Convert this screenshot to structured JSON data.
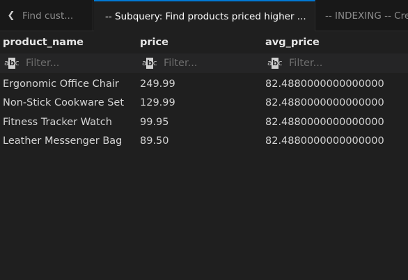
{
  "tabs": [
    {
      "label": "Find cust..."
    },
    {
      "label": "-- Subquery: Find products priced higher ..."
    },
    {
      "label": "-- INDEXING -- Cre"
    }
  ],
  "columns": [
    {
      "header": "product_name",
      "filter_placeholder": "Filter..."
    },
    {
      "header": "price",
      "filter_placeholder": "Filter..."
    },
    {
      "header": "avg_price",
      "filter_placeholder": "Filter..."
    }
  ],
  "rows": [
    [
      "Ergonomic Office Chair",
      "249.99",
      "82.4880000000000000"
    ],
    [
      "Non-Stick Cookware Set",
      "129.99",
      "82.4880000000000000"
    ],
    [
      "Fitness Tracker Watch",
      "99.95",
      "82.4880000000000000"
    ],
    [
      "Leather Messenger Bag",
      "89.50",
      "82.4880000000000000"
    ]
  ],
  "icons": {
    "scroll_left": "chevron-left-icon",
    "filter_type": "text-filter-icon"
  },
  "colors": {
    "background": "#1f1f1f",
    "tabbar": "#181818",
    "active_tab_accent": "#0078d4",
    "filter_row": "#252526"
  }
}
